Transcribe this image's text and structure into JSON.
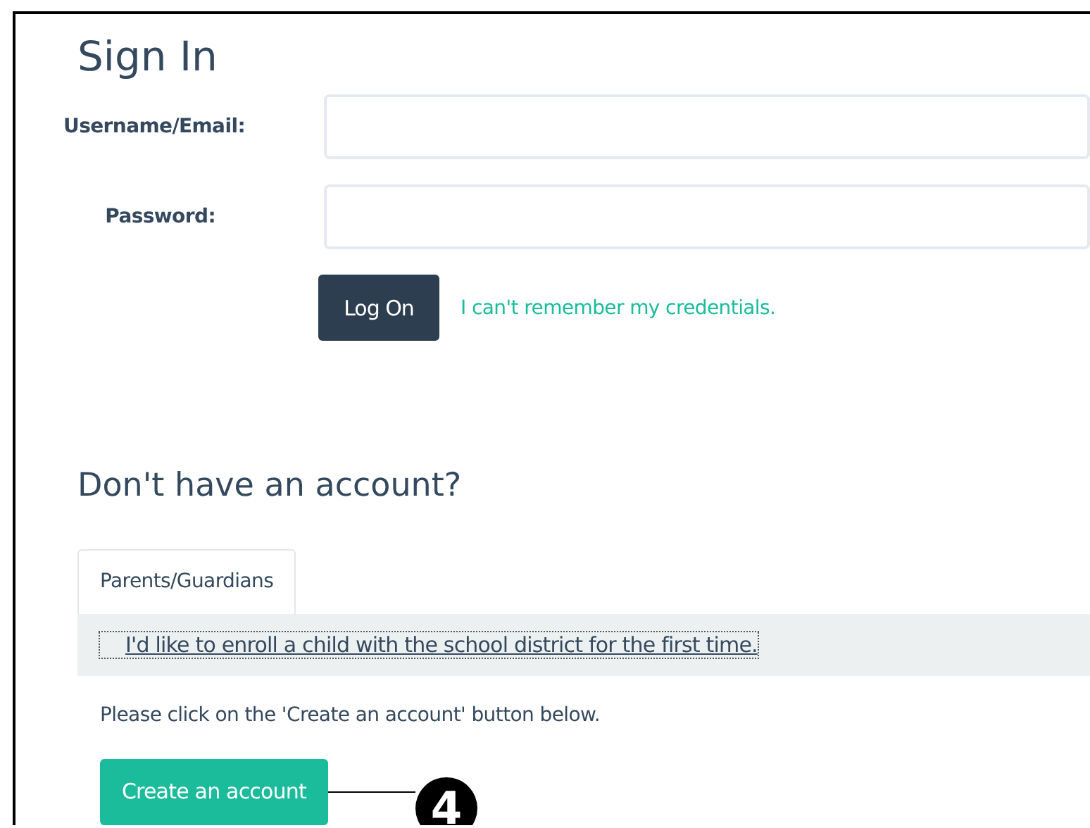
{
  "title": "Sign In",
  "fields": [
    {
      "label": "Username/Email:"
    },
    {
      "label": "Password:"
    }
  ],
  "login_button": "Log On",
  "forgot_link": "I can't remember my credentials.",
  "register": {
    "heading": "Don't have an account?",
    "tabs": [
      {
        "label": "Parents/Guardians",
        "selected": true
      }
    ],
    "option": "I'd like to enroll a child with the school district for the first time.",
    "instruction": "Please click on the 'Create an account' button below.",
    "button": "Create an account"
  },
  "callout": "4"
}
